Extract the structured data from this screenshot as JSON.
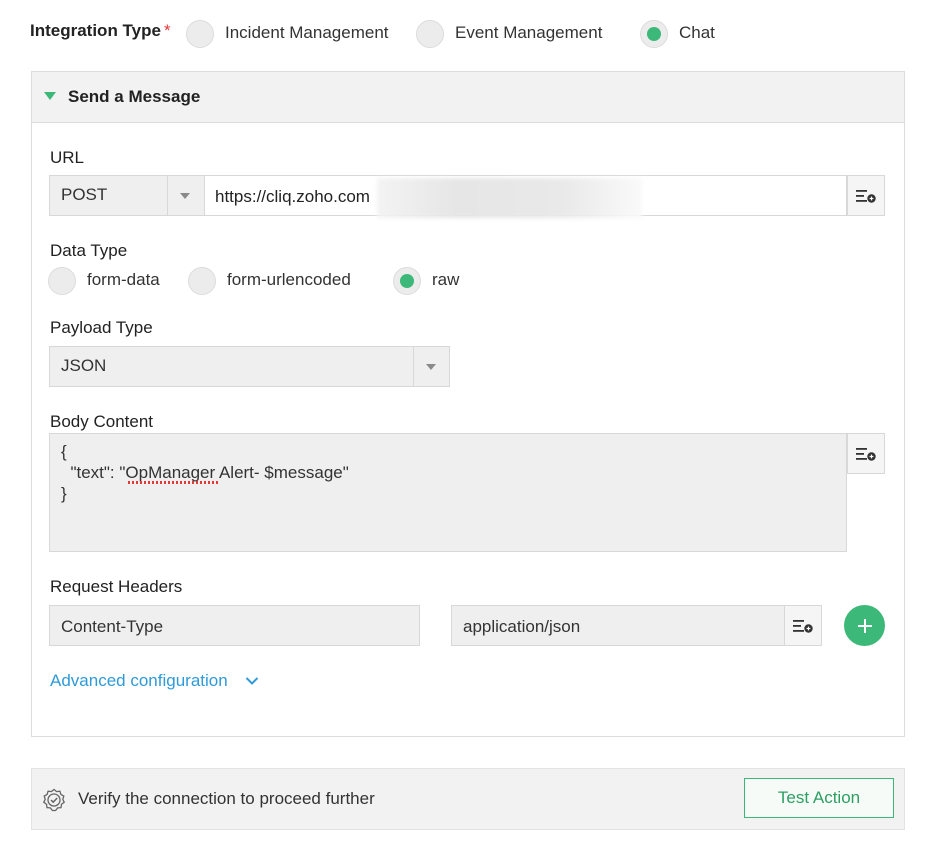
{
  "integration": {
    "label": "Integration Type",
    "required_marker": "*",
    "options": [
      {
        "label": "Incident Management",
        "selected": false
      },
      {
        "label": "Event Management",
        "selected": false
      },
      {
        "label": "Chat",
        "selected": true
      }
    ]
  },
  "section": {
    "title": "Send a Message"
  },
  "url": {
    "label": "URL",
    "method": "POST",
    "value": "https://cliq.zoho.com"
  },
  "data_type": {
    "label": "Data Type",
    "options": [
      {
        "label": "form-data",
        "selected": false
      },
      {
        "label": "form-urlencoded",
        "selected": false
      },
      {
        "label": "raw",
        "selected": true
      }
    ]
  },
  "payload_type": {
    "label": "Payload Type",
    "value": "JSON"
  },
  "body": {
    "label": "Body Content",
    "lines": [
      "{",
      "  \"text\": \"OpManager Alert- $message\"",
      "}"
    ]
  },
  "request_headers": {
    "label": "Request Headers",
    "key": "Content-Type",
    "value": "application/json"
  },
  "advanced": {
    "label": "Advanced configuration"
  },
  "verify": {
    "message": "Verify the connection to proceed further",
    "button": "Test Action"
  },
  "colors": {
    "accent_green": "#3cb878",
    "link_blue": "#2f9ad8",
    "required_red": "#e53935"
  }
}
